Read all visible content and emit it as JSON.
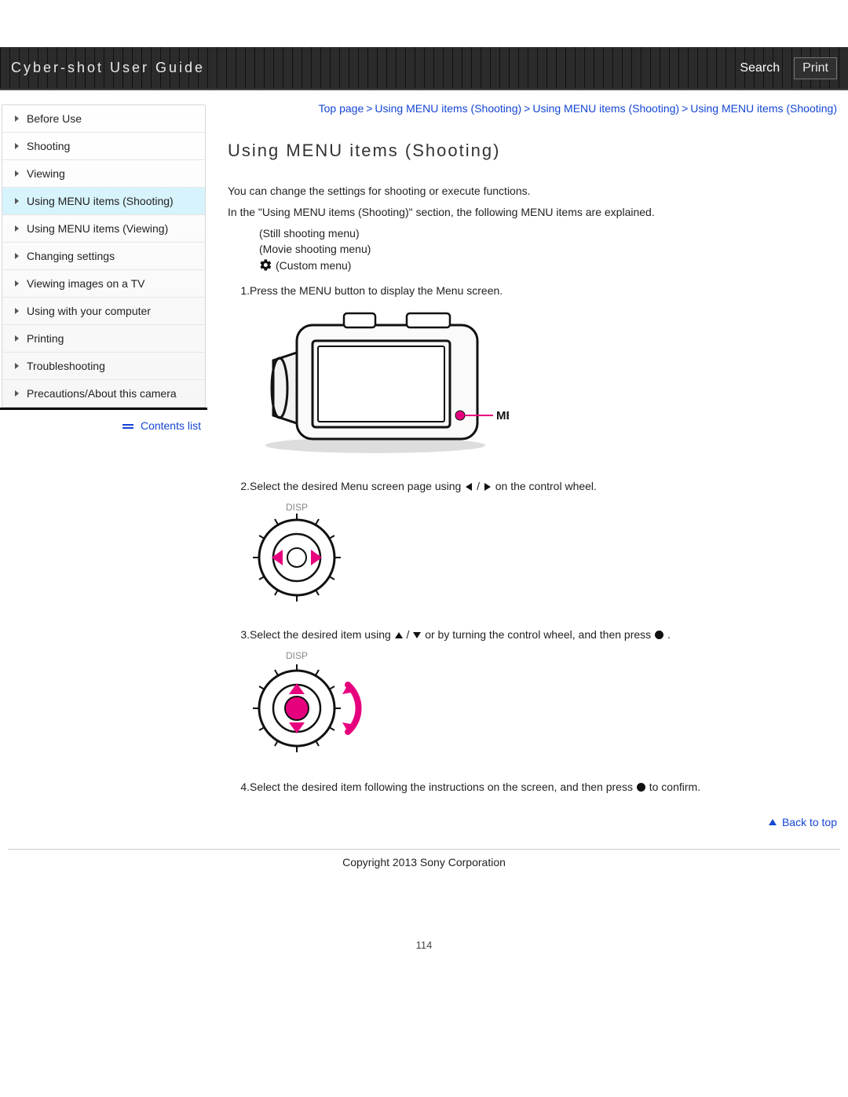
{
  "header": {
    "title": "Cyber-shot User Guide",
    "search": "Search",
    "print": "Print"
  },
  "breadcrumb": {
    "items": [
      "Top page",
      "Using MENU items (Shooting)",
      "Using MENU items (Shooting)",
      "Using MENU items (Shooting)"
    ]
  },
  "sidebar": {
    "items": [
      {
        "label": "Before Use"
      },
      {
        "label": "Shooting"
      },
      {
        "label": "Viewing"
      },
      {
        "label": "Using MENU items (Shooting)"
      },
      {
        "label": "Using MENU items (Viewing)"
      },
      {
        "label": "Changing settings"
      },
      {
        "label": "Viewing images on a TV"
      },
      {
        "label": "Using with your computer"
      },
      {
        "label": "Printing"
      },
      {
        "label": "Troubleshooting"
      },
      {
        "label": "Precautions/About this camera"
      }
    ],
    "active_index": 3,
    "contents_list": "Contents list"
  },
  "doc": {
    "title": "Using MENU items (Shooting)",
    "intro_line1": "You can change the settings for shooting or execute functions.",
    "intro_line2": "In the \"Using MENU items (Shooting)\" section, the following MENU items are explained.",
    "menus": {
      "still": "(Still shooting menu)",
      "movie": "(Movie shooting menu)",
      "custom": "(Custom menu)"
    },
    "steps": {
      "s1": "Press the MENU button to display the Menu screen.",
      "s2a": "Select the desired Menu screen page using ",
      "s2b": " on the control wheel.",
      "s3a": "Select the desired item using ",
      "s3b": " or by turning the control wheel, and then press ",
      "s4a": "Select the desired item following the instructions on the screen, and then press ",
      "s4b": " to confirm."
    },
    "figure_labels": {
      "menu": "MENU",
      "disp1": "DISP",
      "disp2": "DISP"
    }
  },
  "footer": {
    "back_to_top": "Back to top",
    "copyright": "Copyright 2013 Sony Corporation",
    "page_number": "114"
  }
}
